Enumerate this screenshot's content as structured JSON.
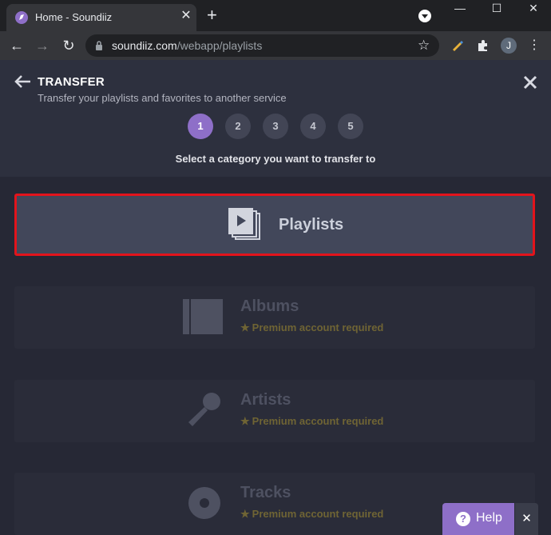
{
  "browser": {
    "tab_title": "Home - Soundiiz",
    "tab_close": "✕",
    "new_tab": "+",
    "url_host": "soundiiz.com",
    "url_path": "/webapp/playlists",
    "avatar_initial": "J",
    "window_controls": {
      "minimize": "—",
      "maximize": "☐",
      "close": "✕"
    }
  },
  "header": {
    "title": "TRANSFER",
    "subtitle": "Transfer your playlists and favorites to another service",
    "steps": [
      "1",
      "2",
      "3",
      "4",
      "5"
    ],
    "active_step": 1,
    "prompt": "Select a category you want to transfer to"
  },
  "categories": [
    {
      "label": "Playlists",
      "icon": "playlist-icon",
      "selected": true
    },
    {
      "label": "Albums",
      "icon": "album-icon",
      "premium": "Premium account required"
    },
    {
      "label": "Artists",
      "icon": "microphone-icon",
      "premium": "Premium account required"
    },
    {
      "label": "Tracks",
      "icon": "disc-icon",
      "premium": "Premium account required"
    }
  ],
  "help": {
    "label": "Help",
    "icon_glyph": "?",
    "close": "✕"
  },
  "colors": {
    "accent": "#8e6fc8",
    "selection_border": "#e2141c",
    "premium_text": "#6f6434",
    "background": "#262835"
  }
}
